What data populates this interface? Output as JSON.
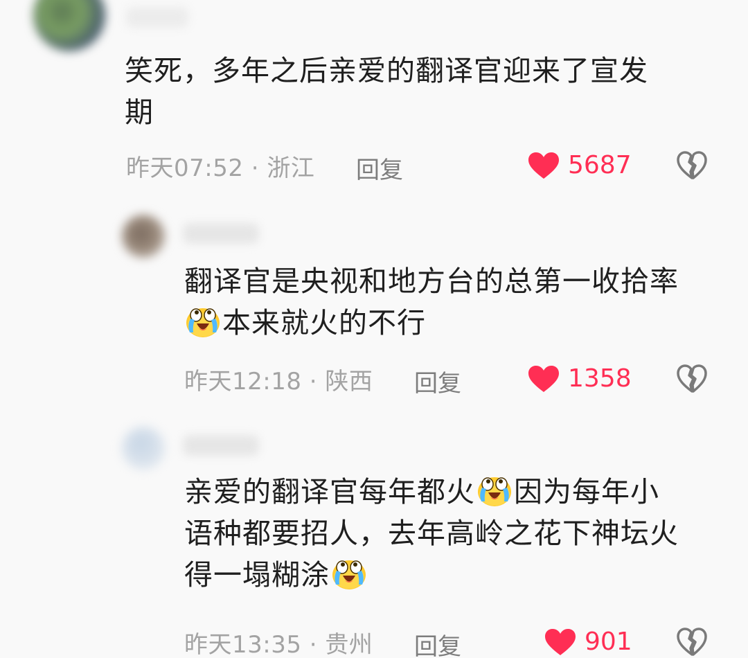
{
  "comments": [
    {
      "text_lines": [
        "笑死，多年之后亲爱的翻译官迎来了宣发",
        "期"
      ],
      "time": "昨天07:52",
      "separator": " · ",
      "location": "浙江",
      "reply_label": "回复",
      "likes": "5687"
    },
    {
      "text_lines": [
        "翻译官是央视和地方台的总第一收拾率",
        "本来就火的不行"
      ],
      "time": "昨天12:18",
      "separator": " · ",
      "location": "陕西",
      "reply_label": "回复",
      "likes": "1358"
    },
    {
      "text_lines": [
        "亲爱的翻译官每年都火",
        "因为每年小",
        "语种都要招人，去年高岭之花下神坛火",
        "得一塌糊涂"
      ],
      "time": "昨天13:35",
      "separator": " · ",
      "location": "贵州",
      "reply_label": "回复",
      "likes": "901"
    }
  ],
  "colors": {
    "like": "#ff2e54",
    "meta": "#a3a3a3",
    "reply": "#7d7d7d",
    "text": "#1f1f1f"
  },
  "icons": {
    "emoji": "crying-laughing-emoji-icon",
    "like": "heart-icon",
    "dislike": "broken-heart-icon"
  }
}
